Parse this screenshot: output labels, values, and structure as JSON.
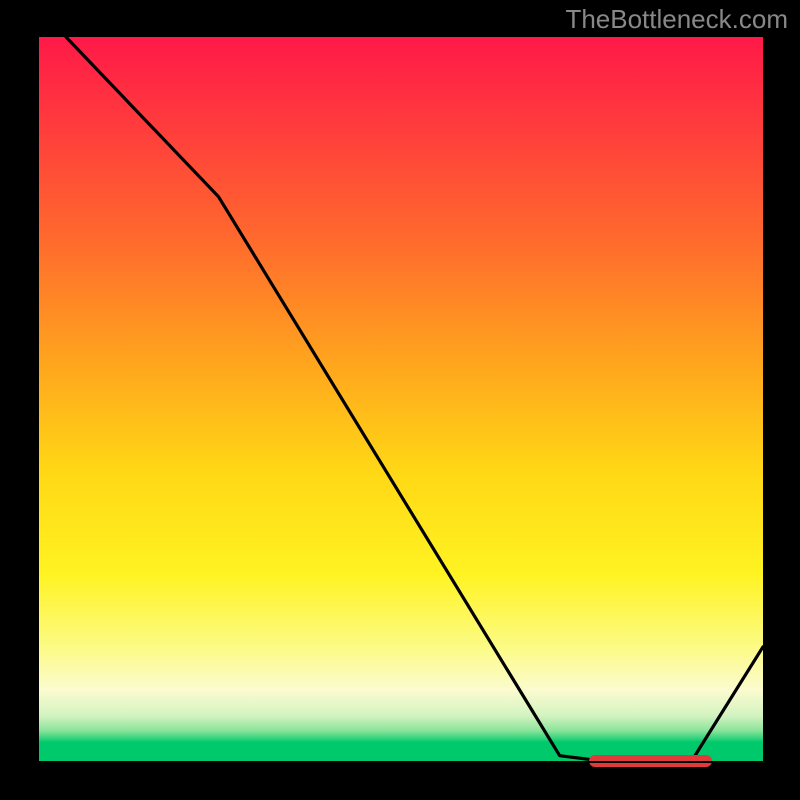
{
  "attribution": "TheBottleneck.com",
  "chart_data": {
    "type": "line",
    "title": "",
    "xlabel": "",
    "ylabel": "",
    "xlim": [
      0,
      100
    ],
    "ylim": [
      0,
      100
    ],
    "x": [
      0,
      4,
      25,
      72,
      80,
      90,
      100
    ],
    "values": [
      110,
      100,
      78,
      1,
      0,
      0,
      16
    ],
    "optimal_band": {
      "x_start": 76,
      "x_end": 93,
      "y": 0
    },
    "gradient_stops": [
      {
        "pct": 0,
        "color": "#ff1948"
      },
      {
        "pct": 12,
        "color": "#ff3b3d"
      },
      {
        "pct": 28,
        "color": "#ff6a2d"
      },
      {
        "pct": 44,
        "color": "#ffa21e"
      },
      {
        "pct": 60,
        "color": "#ffd815"
      },
      {
        "pct": 74,
        "color": "#fff322"
      },
      {
        "pct": 84,
        "color": "#fcfb84"
      },
      {
        "pct": 90,
        "color": "#fbfbd0"
      },
      {
        "pct": 93.5,
        "color": "#d3f3c0"
      },
      {
        "pct": 95.5,
        "color": "#8ce49c"
      },
      {
        "pct": 96.7,
        "color": "#2ad27a"
      },
      {
        "pct": 97.1,
        "color": "#00c96c"
      },
      {
        "pct": 100,
        "color": "#00c96c"
      }
    ]
  }
}
